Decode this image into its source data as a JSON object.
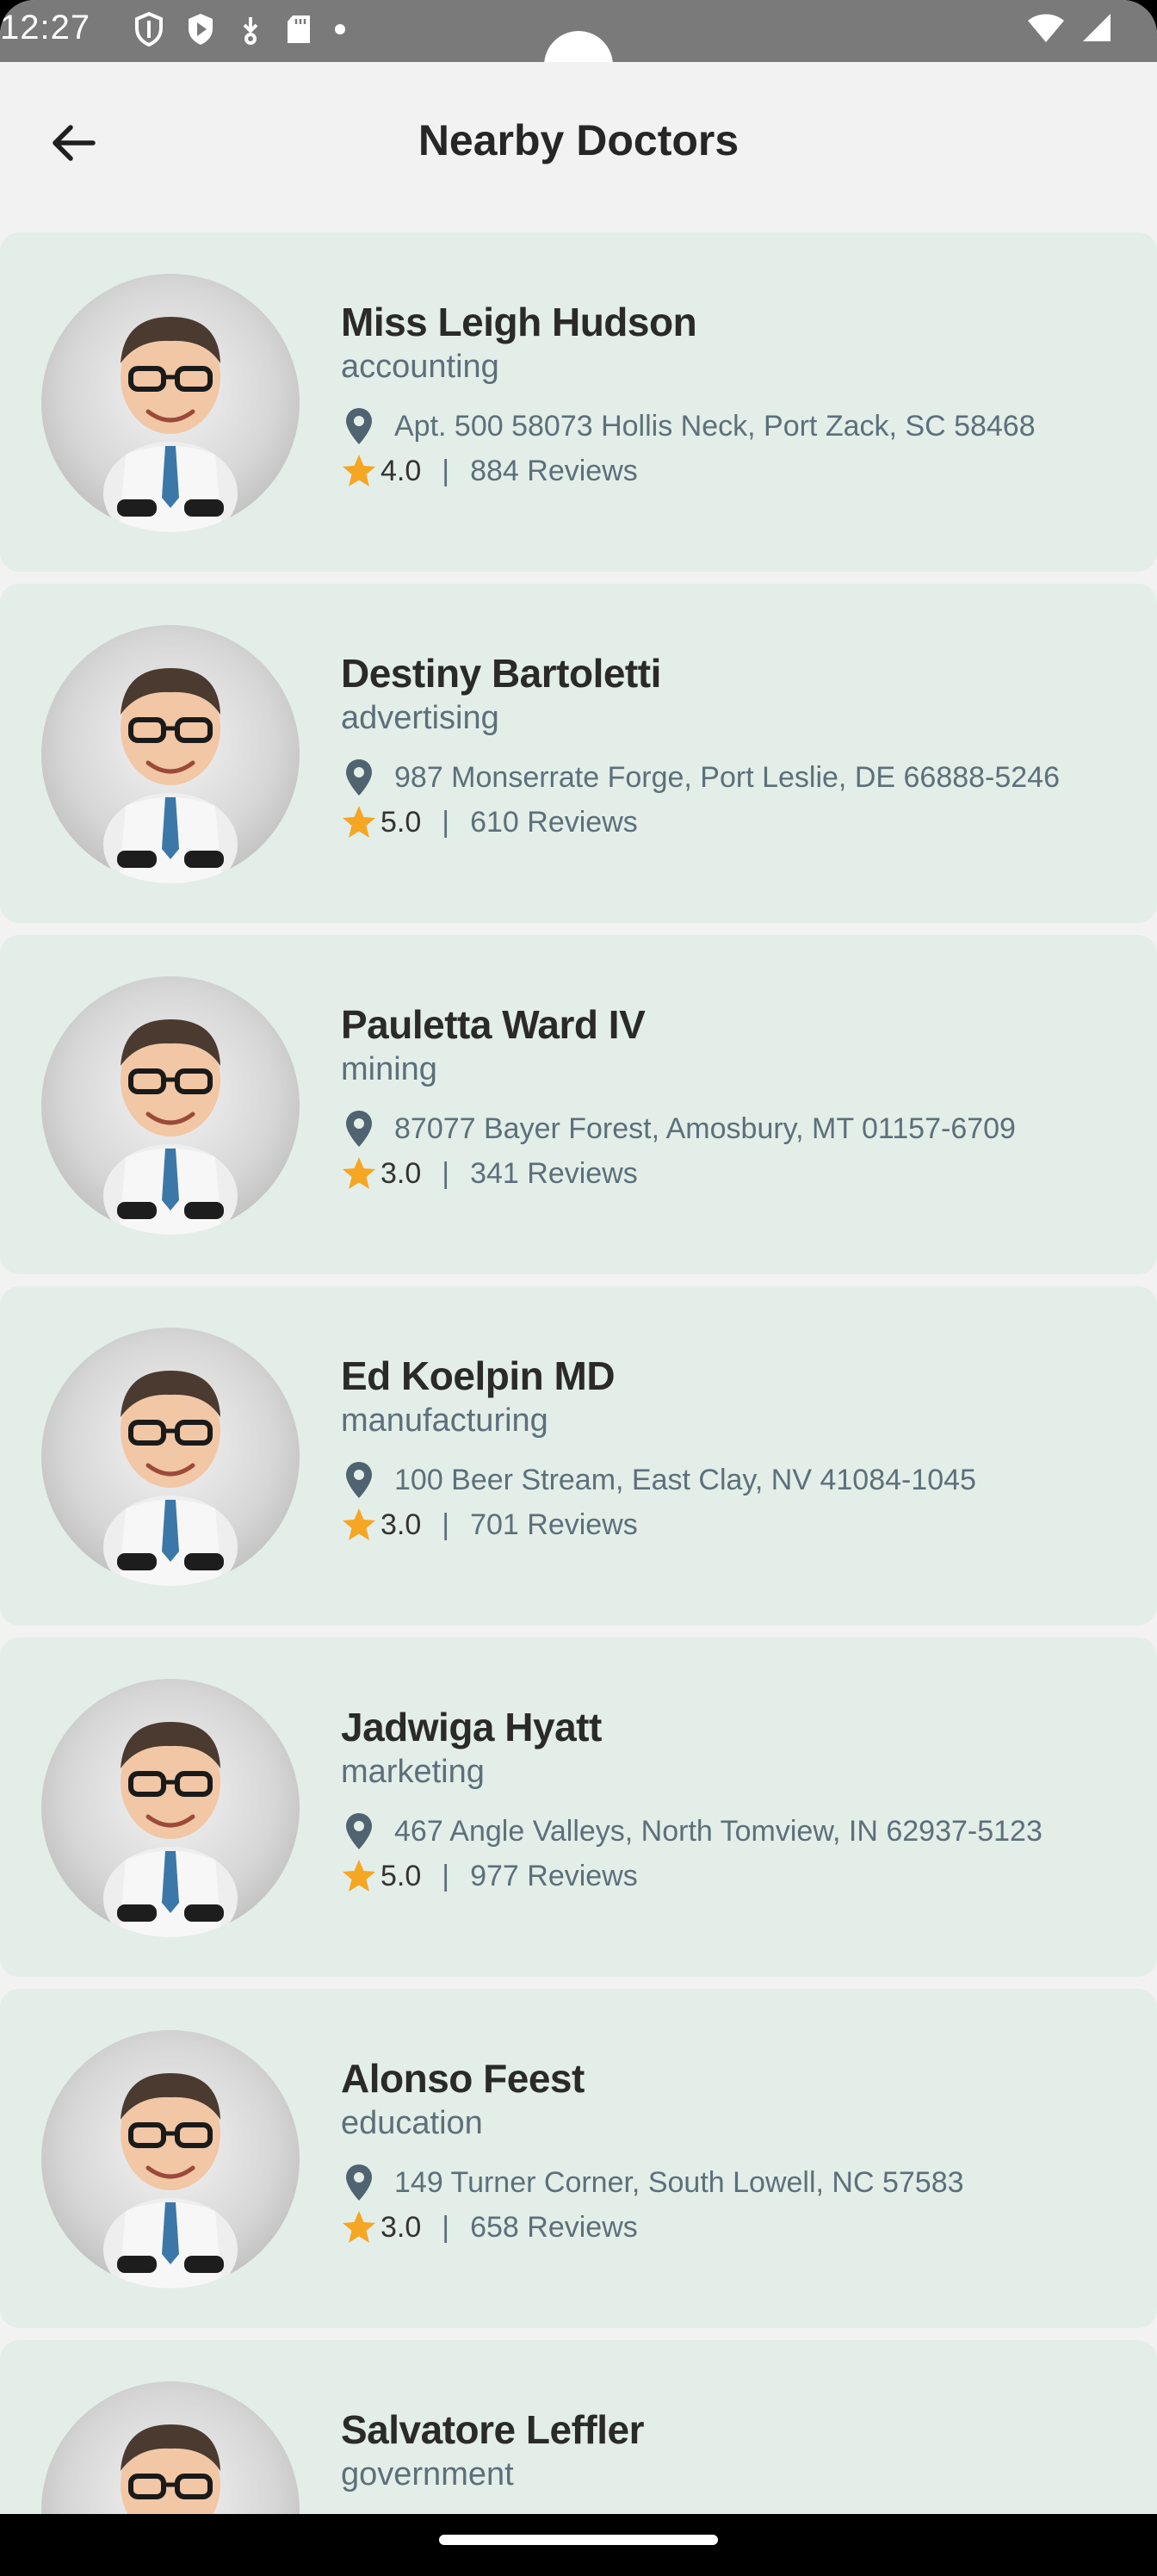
{
  "status_bar": {
    "time": "12:27"
  },
  "header": {
    "title": "Nearby Doctors",
    "back_icon": "arrow-left-icon"
  },
  "doctors": [
    {
      "name": "Miss Leigh Hudson",
      "specialty": "accounting",
      "address": "Apt. 500 58073 Hollis Neck, Port Zack, SC 58468",
      "rating": "4.0",
      "separator": "|",
      "reviews": "884 Reviews"
    },
    {
      "name": "Destiny Bartoletti",
      "specialty": "advertising",
      "address": "987 Monserrate Forge, Port Leslie, DE 66888-5246",
      "rating": "5.0",
      "separator": "|",
      "reviews": "610 Reviews"
    },
    {
      "name": "Pauletta Ward IV",
      "specialty": "mining",
      "address": "87077 Bayer Forest, Amosbury, MT 01157-6709",
      "rating": "3.0",
      "separator": "|",
      "reviews": "341 Reviews"
    },
    {
      "name": "Ed Koelpin MD",
      "specialty": "manufacturing",
      "address": "100 Beer Stream, East Clay, NV 41084-1045",
      "rating": "3.0",
      "separator": "|",
      "reviews": "701 Reviews"
    },
    {
      "name": "Jadwiga Hyatt",
      "specialty": "marketing",
      "address": "467 Angle Valleys, North Tomview, IN 62937-5123",
      "rating": "5.0",
      "separator": "|",
      "reviews": "977 Reviews"
    },
    {
      "name": "Alonso Feest",
      "specialty": "education",
      "address": "149 Turner Corner, South Lowell, NC 57583",
      "rating": "3.0",
      "separator": "|",
      "reviews": "658 Reviews"
    },
    {
      "name": "Salvatore Leffler",
      "specialty": "government",
      "address": "",
      "rating": "",
      "separator": "",
      "reviews": ""
    }
  ],
  "colors": {
    "card_bg": "#e3eee8",
    "accent_star": "#f5a623",
    "secondary_text": "#5d6f7a",
    "pin": "#4f6470"
  }
}
